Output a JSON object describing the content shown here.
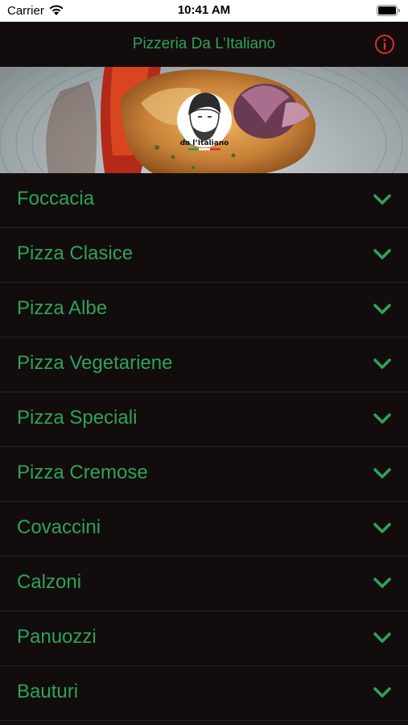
{
  "status_bar": {
    "carrier": "Carrier",
    "time": "10:41 AM"
  },
  "nav": {
    "title": "Pizzeria Da L’Italiano",
    "info_icon": "info-circle-icon"
  },
  "hero": {
    "logo_text": "da l’Italiano"
  },
  "categories": [
    {
      "label": "Foccacia"
    },
    {
      "label": "Pizza Clasice"
    },
    {
      "label": "Pizza Albe"
    },
    {
      "label": "Pizza Vegetariene"
    },
    {
      "label": "Pizza Speciali"
    },
    {
      "label": "Pizza Cremose"
    },
    {
      "label": "Covaccini"
    },
    {
      "label": "Calzoni"
    },
    {
      "label": "Panuozzi"
    },
    {
      "label": "Bauturi"
    }
  ],
  "colors": {
    "background": "#120d0c",
    "accent_green": "#2da25c",
    "info_red": "#d9312b",
    "divider": "#2a2423"
  },
  "icons": {
    "row_chevron": "chevron-down-icon"
  }
}
